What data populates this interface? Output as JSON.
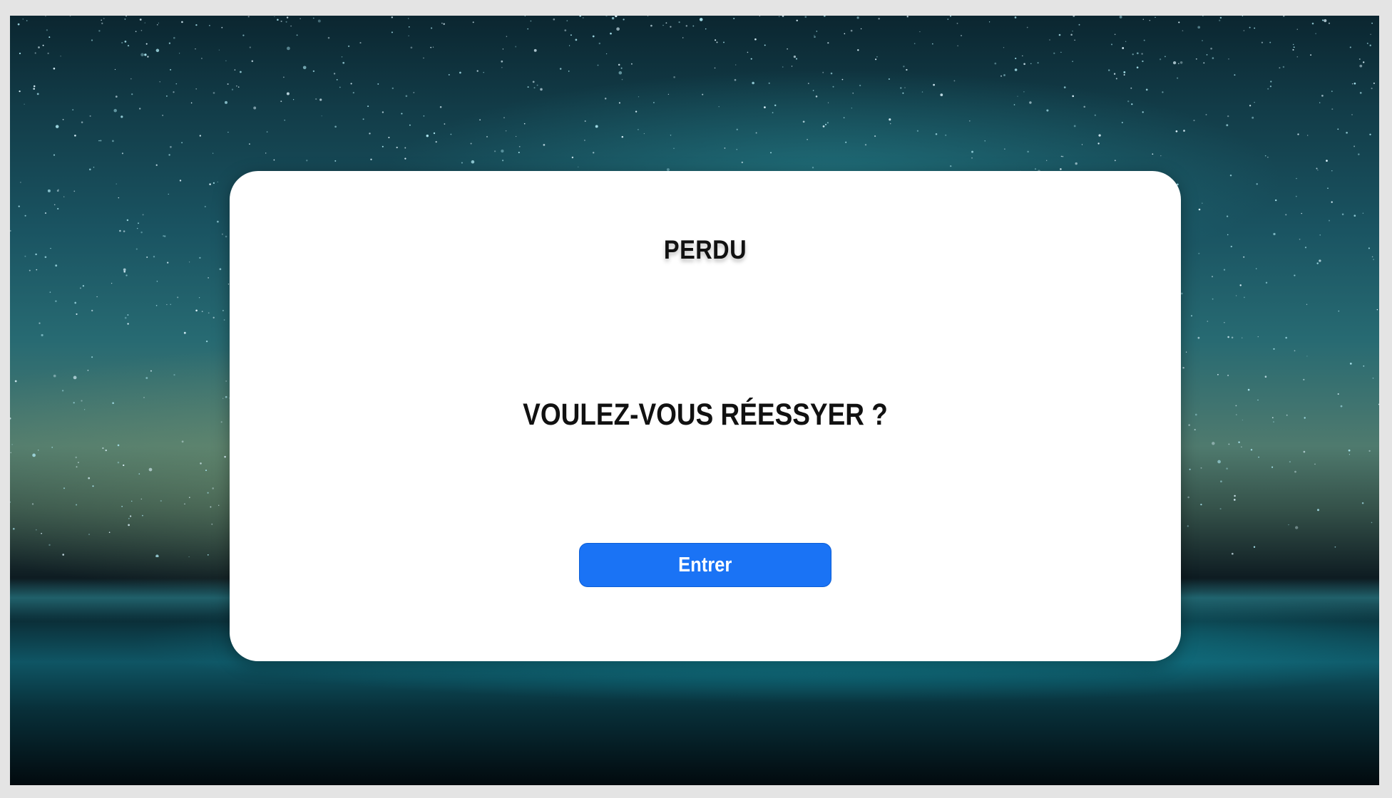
{
  "dialog": {
    "title": "PERDU",
    "question": "VOULEZ-VOUS RÉESSYER ?",
    "button_label": "Entrer"
  },
  "colors": {
    "button_background": "#1a73f5",
    "card_background": "#ffffff",
    "text": "#111111"
  }
}
